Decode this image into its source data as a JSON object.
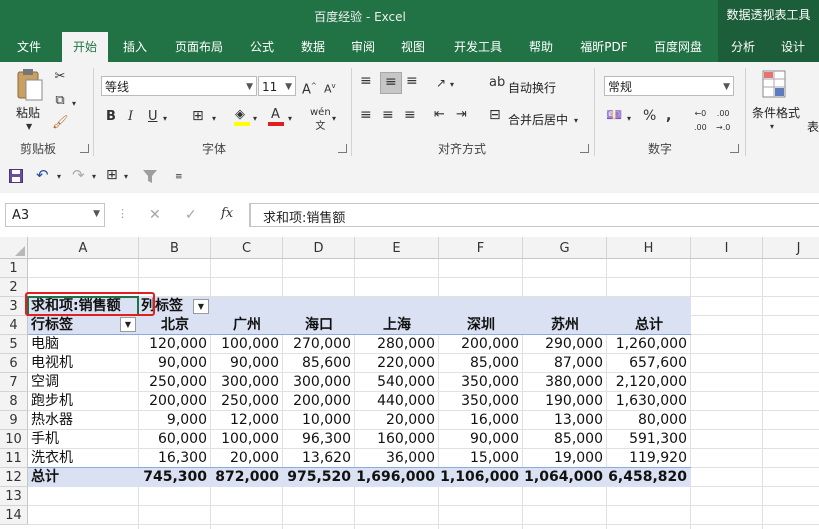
{
  "app": {
    "title": "百度经验  -  Excel",
    "context_tab_group": "数据透视表工具"
  },
  "tabs": [
    "文件",
    "开始",
    "插入",
    "页面布局",
    "公式",
    "数据",
    "审阅",
    "视图",
    "开发工具",
    "帮助",
    "福昕PDF",
    "百度网盘",
    "分析",
    "设计"
  ],
  "ribbon": {
    "clipboard": {
      "paste": "粘贴",
      "label": "剪贴板"
    },
    "font": {
      "name": "等线",
      "size": "11",
      "label": "字体"
    },
    "align": {
      "wrap": "自动换行",
      "merge": "合并后居中",
      "label": "对齐方式"
    },
    "number": {
      "format": "常规",
      "label": "数字"
    },
    "styles": {
      "cond_format": "条件格式",
      "table": "表"
    }
  },
  "formula_bar": {
    "name_box": "A3",
    "fx": "fx",
    "formula": "求和项:销售额"
  },
  "grid": {
    "columns": [
      "A",
      "B",
      "C",
      "D",
      "E",
      "F",
      "G",
      "H",
      "I",
      "J"
    ],
    "rows": [
      "1",
      "2",
      "3",
      "4",
      "5",
      "6",
      "7",
      "8",
      "9",
      "10",
      "11",
      "12",
      "13",
      "14"
    ]
  },
  "pivot": {
    "corner": "求和项:销售额",
    "col_label": "列标签",
    "row_label": "行标签",
    "headers": [
      "北京",
      "广州",
      "海口",
      "上海",
      "深圳",
      "苏州",
      "总计"
    ],
    "rows": [
      {
        "name": "电脑",
        "values": [
          "120,000",
          "100,000",
          "270,000",
          "280,000",
          "200,000",
          "290,000",
          "1,260,000"
        ]
      },
      {
        "name": "电视机",
        "values": [
          "90,000",
          "90,000",
          "85,600",
          "220,000",
          "85,000",
          "87,000",
          "657,600"
        ]
      },
      {
        "name": "空调",
        "values": [
          "250,000",
          "300,000",
          "300,000",
          "540,000",
          "350,000",
          "380,000",
          "2,120,000"
        ]
      },
      {
        "name": "跑步机",
        "values": [
          "200,000",
          "250,000",
          "200,000",
          "440,000",
          "350,000",
          "190,000",
          "1,630,000"
        ]
      },
      {
        "name": "热水器",
        "values": [
          "9,000",
          "12,000",
          "10,000",
          "20,000",
          "16,000",
          "13,000",
          "80,000"
        ]
      },
      {
        "name": "手机",
        "values": [
          "60,000",
          "100,000",
          "96,300",
          "160,000",
          "90,000",
          "85,000",
          "591,300"
        ]
      },
      {
        "name": "洗衣机",
        "values": [
          "16,300",
          "20,000",
          "13,620",
          "36,000",
          "15,000",
          "19,000",
          "119,920"
        ]
      }
    ],
    "total": {
      "name": "总计",
      "values": [
        "745,300",
        "872,000",
        "975,520",
        "1,696,000",
        "1,106,000",
        "1,064,000",
        "6,458,820"
      ]
    }
  },
  "colors": {
    "brand": "#217346",
    "highlight": "#e02020",
    "pivot_fill": "#d9e1f2"
  }
}
